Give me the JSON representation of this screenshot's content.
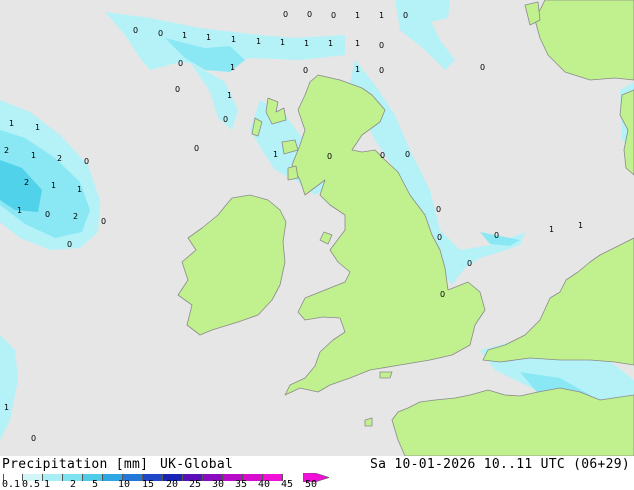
{
  "map": {
    "colors": {
      "sea": "#e6e6e6",
      "land": "#c1f08e",
      "coast": "#8a8a8a",
      "precip_light": "#b4f2f8",
      "precip_mid": "#8ae8f4",
      "precip_heavy": "#4fd2ea"
    },
    "values": [
      "0",
      "0",
      "1",
      "1",
      "1",
      "1",
      "1",
      "1",
      "1",
      "0",
      "0",
      "0",
      "1",
      "1",
      "0",
      "1",
      "0",
      "1",
      "0",
      "0",
      "1",
      "0",
      "0",
      "0",
      "0",
      "1",
      "1",
      "1",
      "2",
      "1",
      "2",
      "0",
      "2",
      "1",
      "1",
      "1",
      "2",
      "0",
      "0",
      "0",
      "0",
      "1",
      "0",
      "0",
      "0",
      "0",
      "0",
      "0",
      "0",
      "1",
      "1",
      "0",
      "1",
      "0"
    ]
  },
  "footer": {
    "title": "Precipitation [mm]",
    "model": "UK-Global",
    "datetime": "Sa 10-01-2026 10..11 UTC (06+29)",
    "colorbar": {
      "ticks": [
        "0.1",
        "0.5",
        "1",
        "2",
        "5",
        "10",
        "15",
        "20",
        "25",
        "30",
        "35",
        "40",
        "45",
        "50"
      ],
      "colors": [
        "#ffffff",
        "#d2f6f8",
        "#a8eef4",
        "#7fe2f0",
        "#4fcce8",
        "#2ea8e4",
        "#2478d8",
        "#1e48c8",
        "#1a24b4",
        "#5a10b8",
        "#8a0cc0",
        "#b80cc8",
        "#d80ccc",
        "#f010d8"
      ]
    }
  }
}
